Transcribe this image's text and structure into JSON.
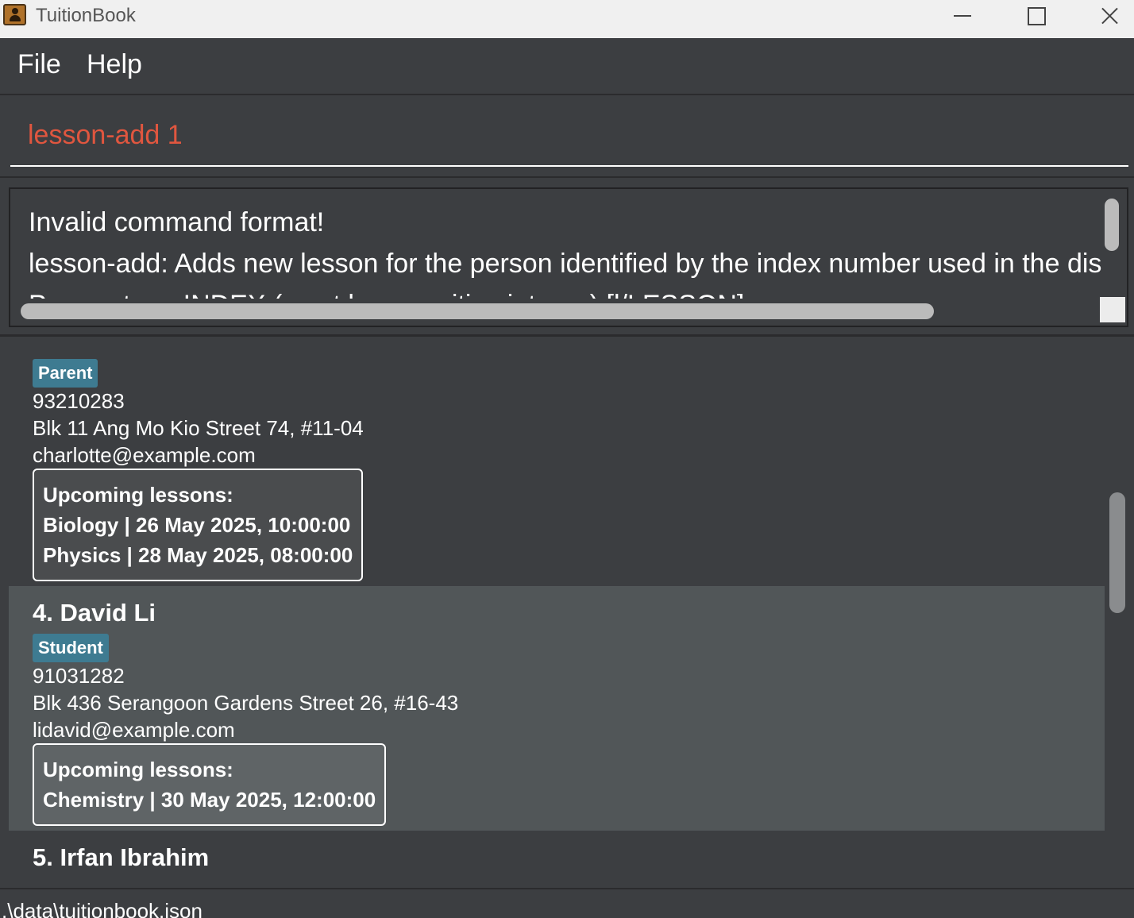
{
  "window": {
    "title": "TuitionBook",
    "icon": "address-book-icon",
    "controls": [
      "minimize-icon",
      "maximize-icon",
      "close-icon"
    ]
  },
  "menu": {
    "file": "File",
    "help": "Help"
  },
  "command": {
    "value": "lesson-add 1",
    "error_color": "#e0563f"
  },
  "result": {
    "lines": [
      "Invalid command format!",
      "lesson-add: Adds new lesson for the person identified by the index number used in the displa",
      "Parameters: INDEX (must be a positive integer) [l/LESSON]"
    ]
  },
  "persons": [
    {
      "name": "",
      "tag": "Parent",
      "phone": "93210283",
      "address": "Blk 11 Ang Mo Kio Street 74, #11-04",
      "email": "charlotte@example.com",
      "lessons_header": "Upcoming lessons:",
      "lessons": [
        "Biology | 26 May 2025, 10:00:00",
        "Physics | 28 May 2025, 08:00:00"
      ]
    },
    {
      "name": "4. David Li",
      "tag": "Student",
      "phone": "91031282",
      "address": "Blk 436 Serangoon Gardens Street 26, #16-43",
      "email": "lidavid@example.com",
      "lessons_header": "Upcoming lessons:",
      "lessons": [
        "Chemistry | 30 May 2025, 12:00:00"
      ]
    },
    {
      "name": "5. Irfan Ibrahim"
    }
  ],
  "status": {
    "file_path": ".\\data\\tuitionbook.json"
  },
  "colors": {
    "background": "#3c3e41",
    "selected_card": "#515658",
    "tag": "#3e7b91"
  }
}
